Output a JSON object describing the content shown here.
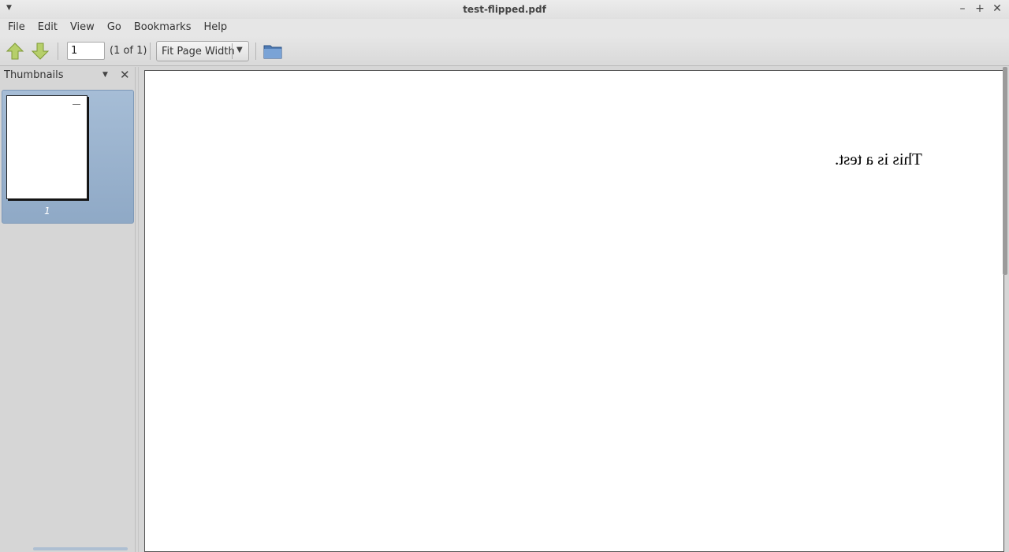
{
  "window": {
    "title": "test-flipped.pdf",
    "controls": [
      "minimize-icon",
      "maximize-icon",
      "close-icon"
    ]
  },
  "menubar": {
    "items": [
      {
        "id": "file",
        "label": "File"
      },
      {
        "id": "edit",
        "label": "Edit"
      },
      {
        "id": "view",
        "label": "View"
      },
      {
        "id": "go",
        "label": "Go"
      },
      {
        "id": "bookmarks",
        "label": "Bookmarks"
      },
      {
        "id": "help",
        "label": "Help"
      }
    ]
  },
  "toolbar": {
    "prev_icon": "arrow-up-icon",
    "next_icon": "arrow-down-icon",
    "page_value": "1",
    "page_count": "(1 of 1)",
    "zoom_label": "Fit Page Width",
    "open_icon": "folder-icon"
  },
  "sidebar": {
    "title": "Thumbnails",
    "thumbnails": [
      {
        "page": "1",
        "selected": true
      }
    ]
  },
  "document": {
    "text": "This is a test.",
    "text_mirrored": true
  },
  "colors": {
    "selection": "#97afcb",
    "arrow_green": "#a8c45a",
    "folder_blue": "#5b86bd"
  }
}
